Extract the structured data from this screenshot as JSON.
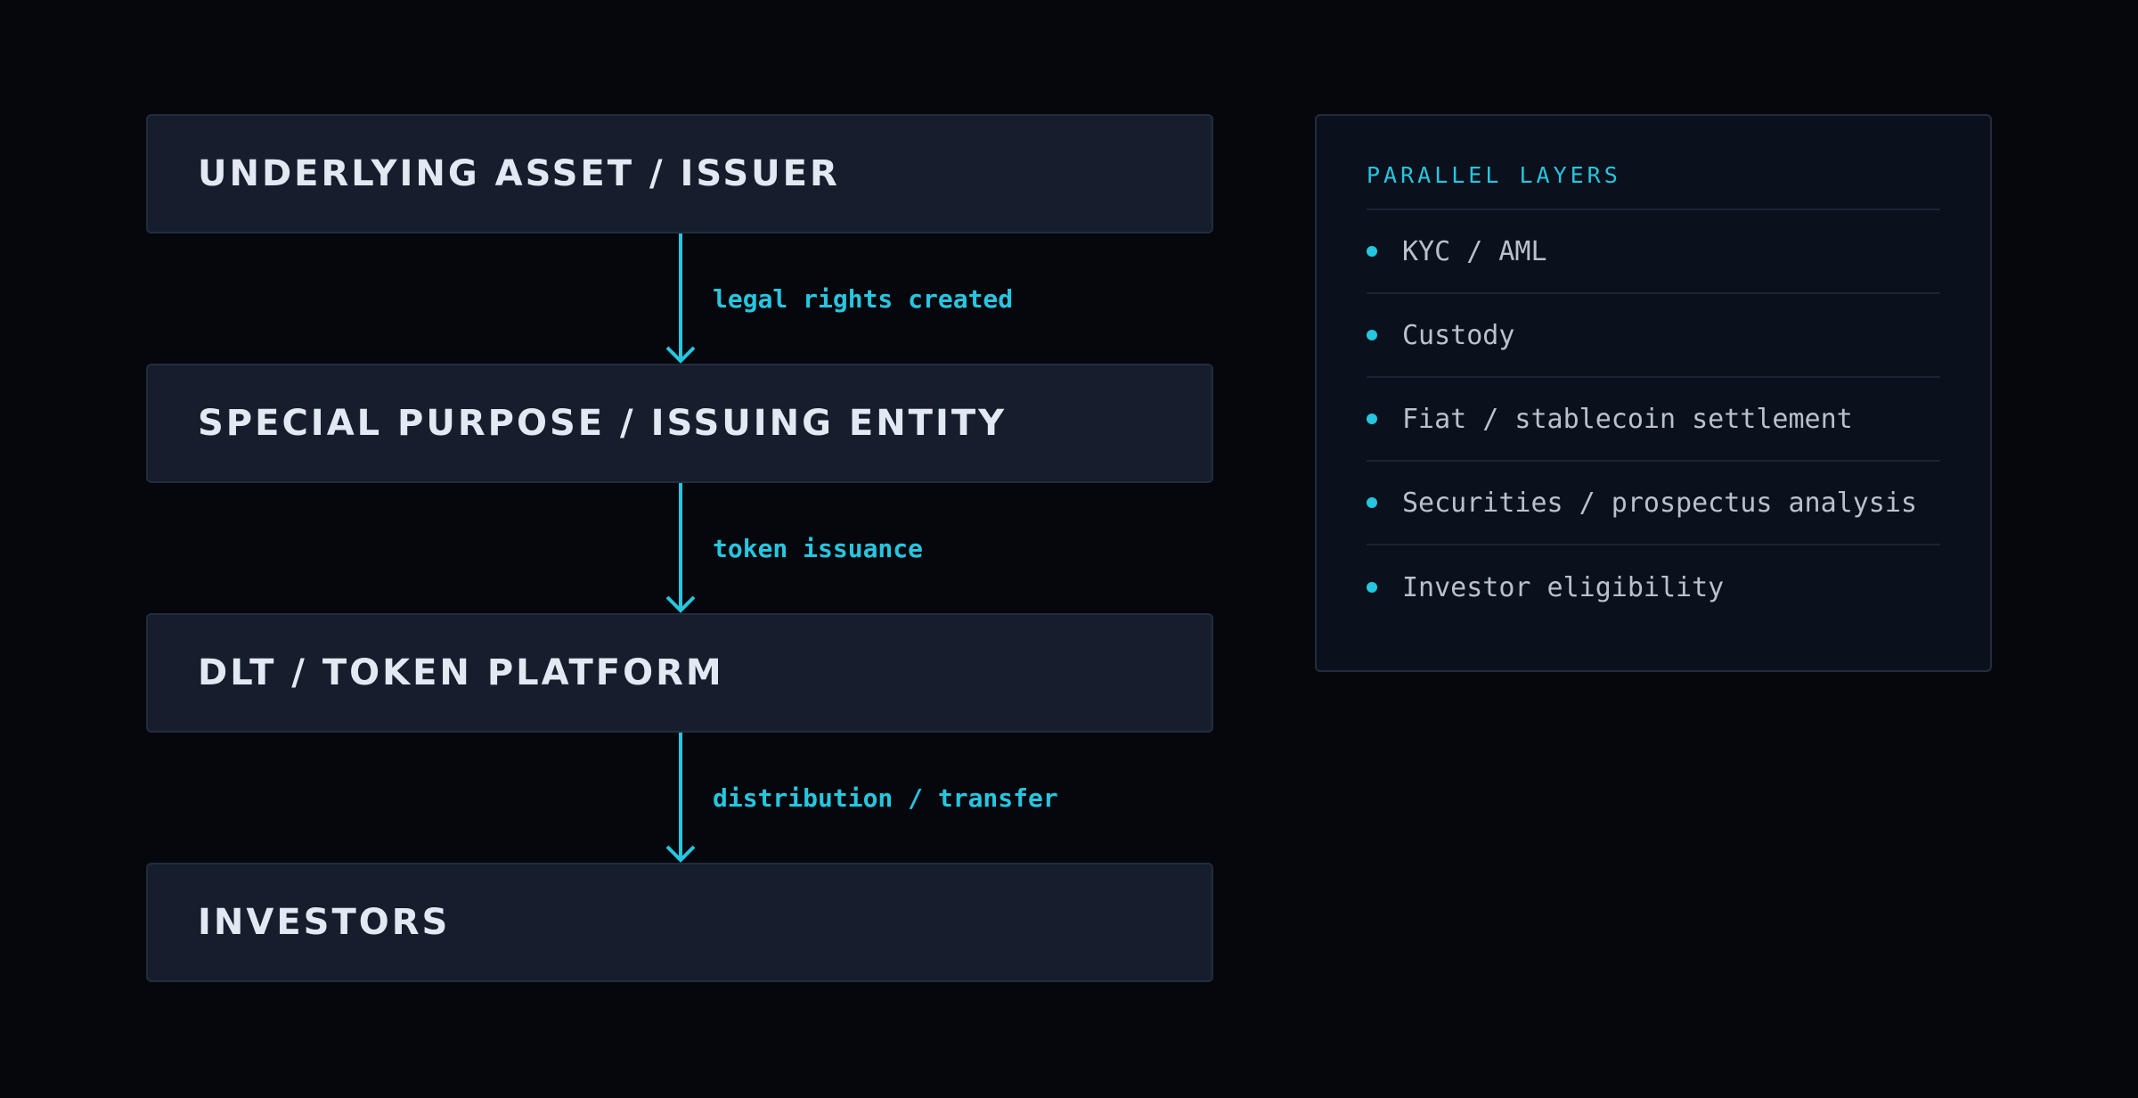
{
  "colors": {
    "background": "#05070c",
    "box_fill": "#161e2e",
    "box_border": "#222c3d",
    "box_text": "#e3e9f3",
    "accent": "#26c6e0",
    "panel_fill": "#0b111c",
    "panel_text": "#b9c1cd"
  },
  "flow": {
    "nodes": [
      {
        "label": "UNDERLYING ASSET / ISSUER"
      },
      {
        "label": "SPECIAL PURPOSE / ISSUING ENTITY"
      },
      {
        "label": "DLT / TOKEN PLATFORM"
      },
      {
        "label": "INVESTORS"
      }
    ],
    "edges": [
      {
        "from": "UNDERLYING ASSET / ISSUER",
        "to": "SPECIAL PURPOSE / ISSUING ENTITY",
        "label": "legal rights created"
      },
      {
        "from": "SPECIAL PURPOSE / ISSUING ENTITY",
        "to": "DLT / TOKEN PLATFORM",
        "label": "token issuance"
      },
      {
        "from": "DLT / TOKEN PLATFORM",
        "to": "INVESTORS",
        "label": "distribution / transfer"
      }
    ]
  },
  "panel": {
    "title": "PARALLEL LAYERS",
    "items": [
      "KYC / AML",
      "Custody",
      "Fiat / stablecoin settlement",
      "Securities / prospectus analysis",
      "Investor eligibility"
    ]
  }
}
